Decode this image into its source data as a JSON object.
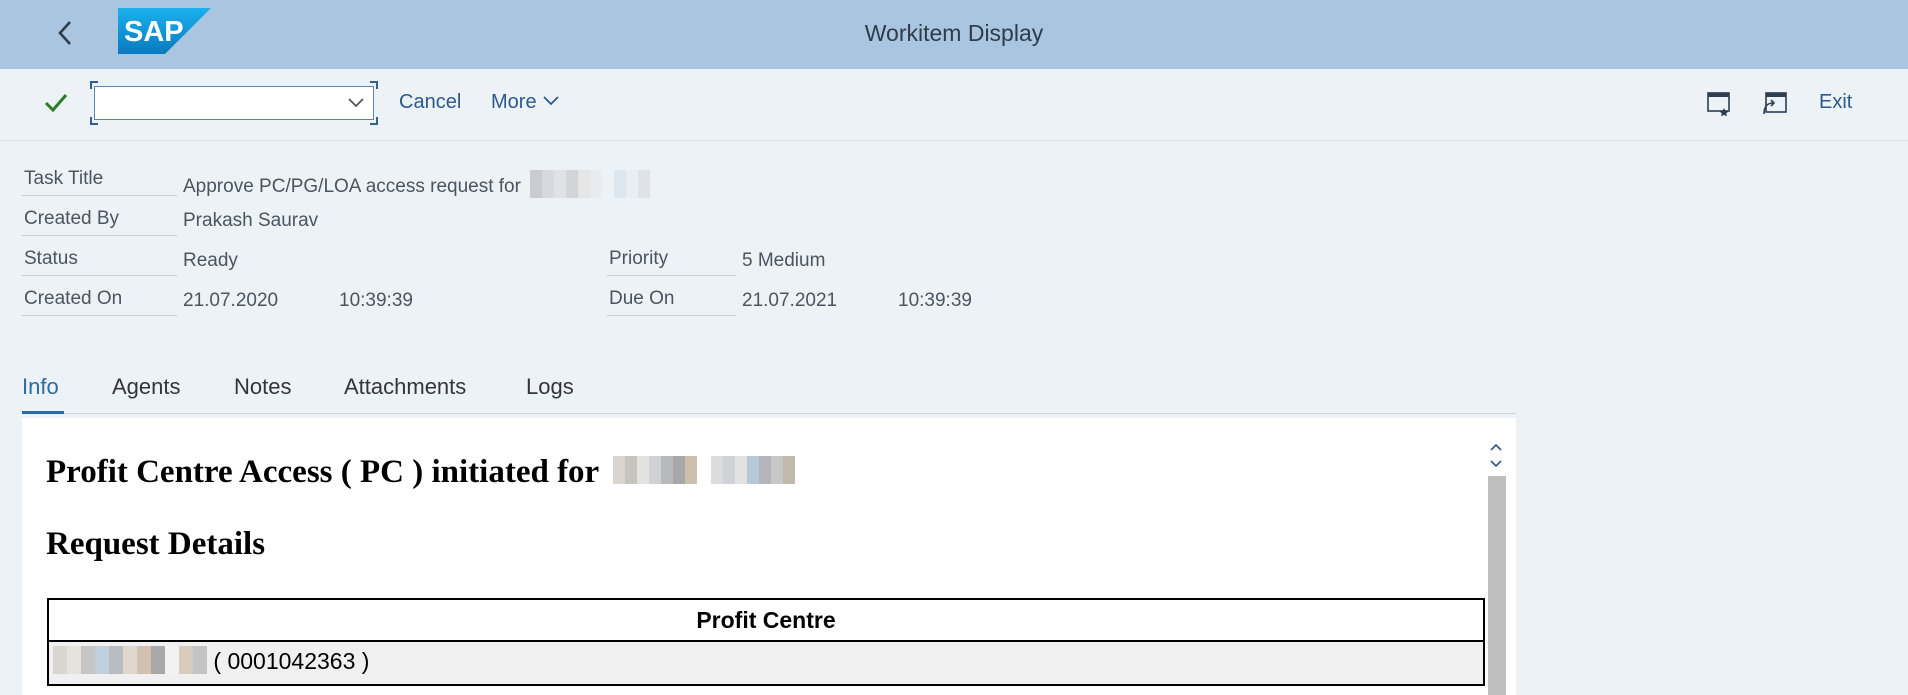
{
  "header": {
    "title": "Workitem Display",
    "logo_text": "SAP"
  },
  "toolbar": {
    "command_value": "",
    "cancel_label": "Cancel",
    "more_label": "More",
    "exit_label": "Exit"
  },
  "fields": {
    "task_title_label": "Task Title",
    "task_title_value": "Approve PC/PG/LOA access request for",
    "created_by_label": "Created By",
    "created_by_value": "Prakash Saurav",
    "status_label": "Status",
    "status_value": "Ready",
    "priority_label": "Priority",
    "priority_value": "5 Medium",
    "created_on_label": "Created On",
    "created_on_date": "21.07.2020",
    "created_on_time": "10:39:39",
    "due_on_label": "Due On",
    "due_on_date": "21.07.2021",
    "due_on_time": "10:39:39"
  },
  "tabs": [
    {
      "label": "Info",
      "active": true
    },
    {
      "label": "Agents"
    },
    {
      "label": "Notes"
    },
    {
      "label": "Attachments"
    },
    {
      "label": "Logs"
    }
  ],
  "content": {
    "heading1": "Profit Centre Access ( PC ) initiated for",
    "heading2": "Request Details",
    "table_header": "Profit Centre",
    "table_row_code": "( 0001042363 )"
  },
  "colors": {
    "header_bg": "#a9c5df",
    "accent": "#2c6ba3",
    "check_green": "#2b7d2b"
  }
}
